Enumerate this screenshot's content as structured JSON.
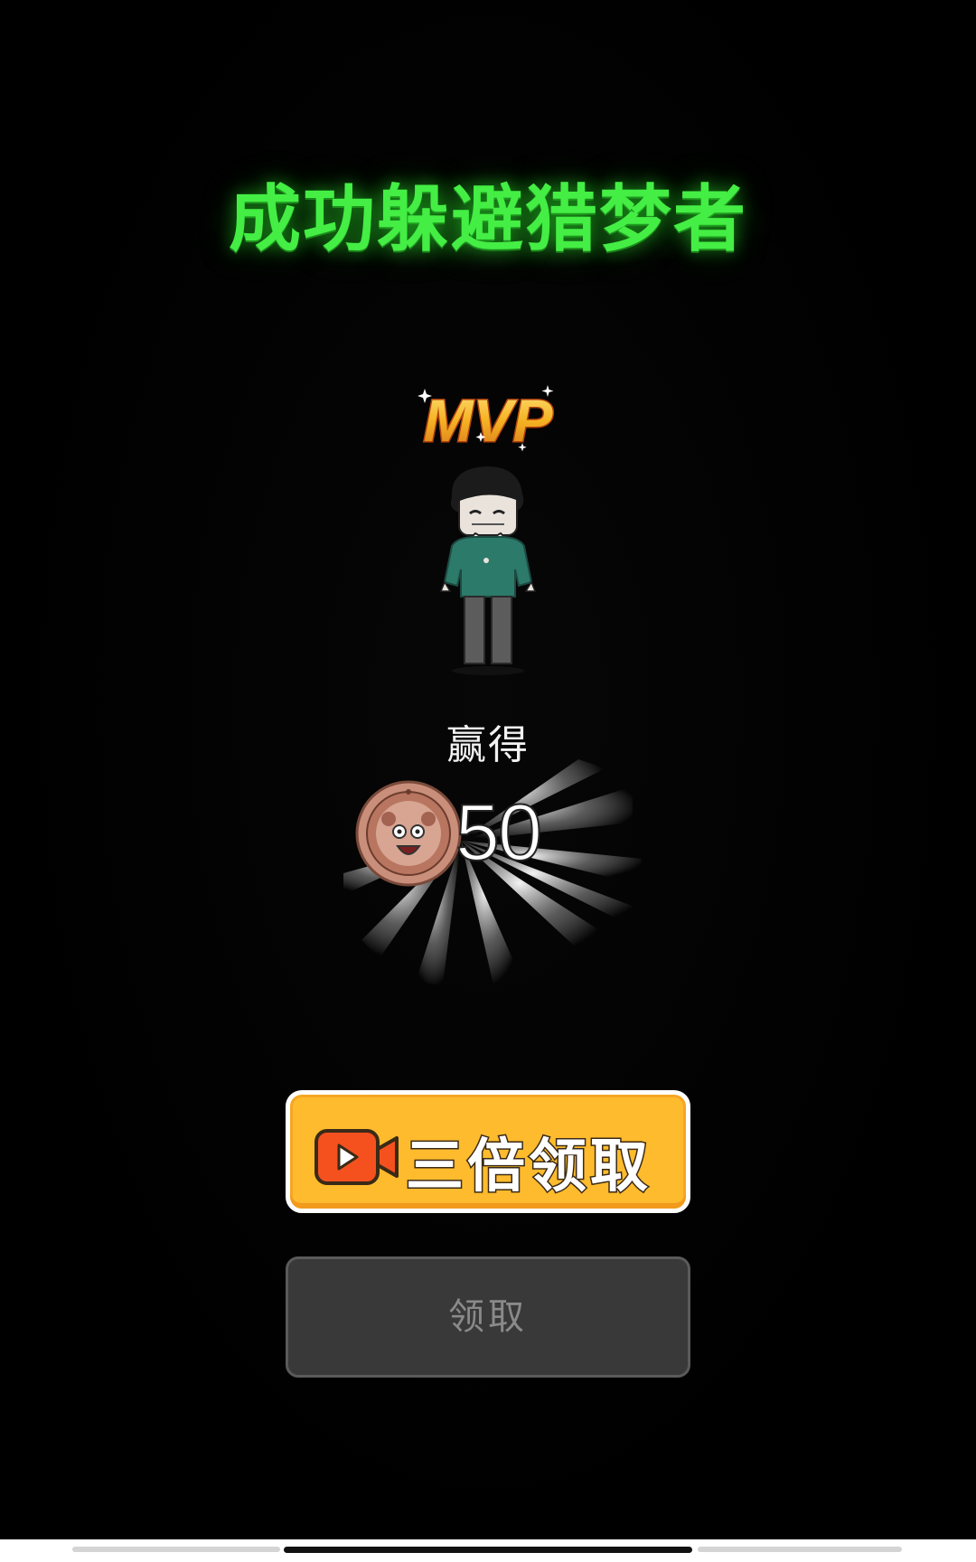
{
  "title": "成功躲避猎梦者",
  "badge": {
    "text": "MVP",
    "color": "#f5c23a",
    "outline": "#c8520f"
  },
  "reward": {
    "label": "赢得",
    "amount": "50",
    "coin_icon": "bear-coin-icon"
  },
  "buttons": {
    "triple": {
      "label": "三倍领取",
      "icon": "video-play-icon",
      "bg": "#fdbb2d",
      "icon_color": "#f4511e"
    },
    "claim": {
      "label": "领取"
    }
  },
  "colors": {
    "title": "#44ee44",
    "background": "#000000"
  }
}
